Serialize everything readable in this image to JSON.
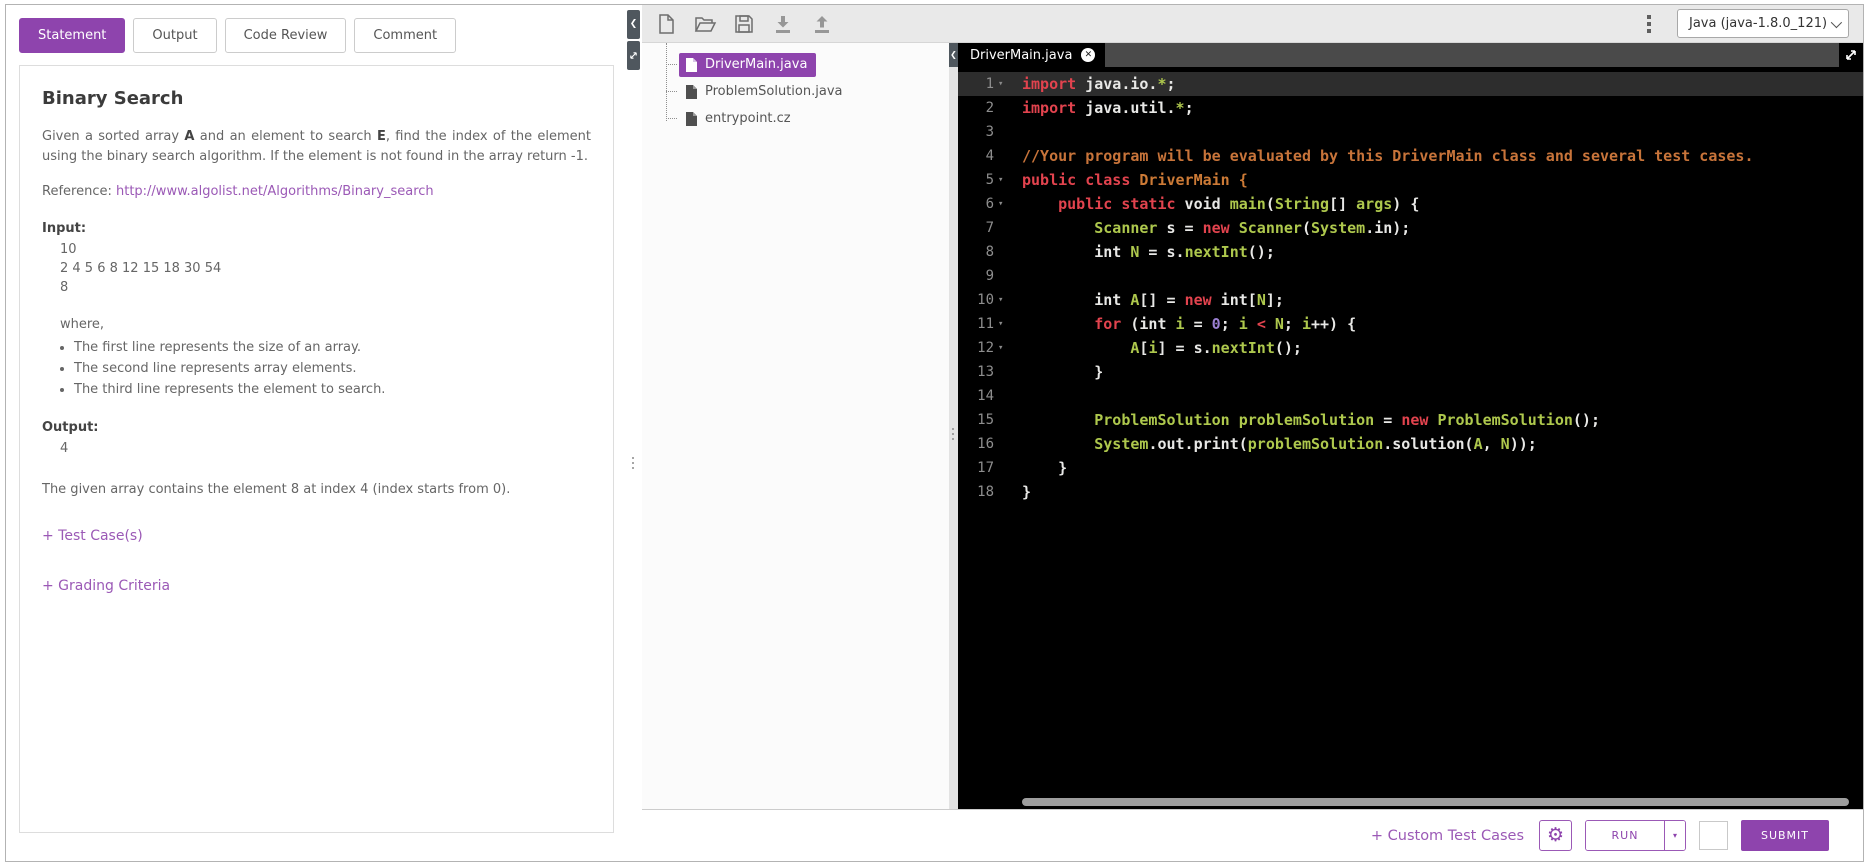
{
  "accent_color": "#8e44ad",
  "link_color": "#9b59b6",
  "left_panel": {
    "tabs": [
      {
        "label": "Statement",
        "active": true
      },
      {
        "label": "Output",
        "active": false
      },
      {
        "label": "Code Review",
        "active": false
      },
      {
        "label": "Comment",
        "active": false
      }
    ],
    "title": "Binary Search",
    "description": [
      {
        "t": "Given a sorted array "
      },
      {
        "b": "A"
      },
      {
        "t": " and an element to search "
      },
      {
        "b": "E"
      },
      {
        "t": ", find the index of the element using the binary search algorithm. If the element is not found in the array return -1."
      }
    ],
    "reference_label": "Reference: ",
    "reference_link": "http://www.algolist.net/Algorithms/Binary_search",
    "input_label": "Input:",
    "input_lines": [
      "10",
      "2 4 5 6 8 12 15 18 30 54",
      "8"
    ],
    "where_label": "where,",
    "input_bullets": [
      "The first line represents the size of an array.",
      "The second line represents array elements.",
      "The third line represents the element to search."
    ],
    "output_label": "Output:",
    "output_value": "4",
    "explanation": "The given array contains the element 8 at index 4 (index starts from 0).",
    "expanders": [
      "+ Test Case(s)",
      "+ Grading Criteria"
    ]
  },
  "file_toolbar": {
    "icons": [
      "new-file-icon",
      "open-folder-icon",
      "save-icon",
      "download-icon",
      "upload-icon"
    ]
  },
  "file_tree": {
    "files": [
      {
        "name": "DriverMain.java",
        "selected": true
      },
      {
        "name": "ProblemSolution.java",
        "selected": false
      },
      {
        "name": "entrypoint.cz",
        "selected": false
      }
    ]
  },
  "language_select": {
    "value": "Java (java-1.8.0_121)"
  },
  "editor": {
    "tab": "DriverMain.java",
    "syntax_colors": {
      "k": "#e2434e",
      "w": "#e8e8e6",
      "g": "#aec84d",
      "n": "#9a7fd1",
      "c": "#c8743a",
      "o": "#cc7a36"
    },
    "lines": [
      {
        "n": 1,
        "fold": true,
        "active": true,
        "tokens": [
          [
            "k",
            "import"
          ],
          [
            "w",
            " java.io."
          ],
          [
            "g",
            "*"
          ],
          [
            "w",
            ";"
          ]
        ]
      },
      {
        "n": 2,
        "tokens": [
          [
            "k",
            "import"
          ],
          [
            "w",
            " java.util."
          ],
          [
            "g",
            "*"
          ],
          [
            "w",
            ";"
          ]
        ]
      },
      {
        "n": 3,
        "tokens": []
      },
      {
        "n": 4,
        "tokens": [
          [
            "c",
            "//Your program will be evaluated by this DriverMain class and several test cases."
          ]
        ]
      },
      {
        "n": 5,
        "fold": true,
        "tokens": [
          [
            "k",
            "public class"
          ],
          [
            "o",
            " DriverMain {"
          ]
        ]
      },
      {
        "n": 6,
        "fold": true,
        "tokens": [
          [
            "w",
            "    "
          ],
          [
            "k",
            "public static"
          ],
          [
            "w",
            " void "
          ],
          [
            "g",
            "main"
          ],
          [
            "w",
            "("
          ],
          [
            "g",
            "String"
          ],
          [
            "w",
            "[] "
          ],
          [
            "g",
            "args"
          ],
          [
            "w",
            ") {"
          ]
        ]
      },
      {
        "n": 7,
        "tokens": [
          [
            "w",
            "        "
          ],
          [
            "g",
            "Scanner"
          ],
          [
            "w",
            " s = "
          ],
          [
            "k",
            "new"
          ],
          [
            "w",
            " "
          ],
          [
            "g",
            "Scanner"
          ],
          [
            "w",
            "("
          ],
          [
            "g",
            "System"
          ],
          [
            "w",
            ".in);"
          ]
        ]
      },
      {
        "n": 8,
        "tokens": [
          [
            "w",
            "        int "
          ],
          [
            "g",
            "N"
          ],
          [
            "w",
            " = s."
          ],
          [
            "g",
            "nextInt"
          ],
          [
            "w",
            "();"
          ]
        ]
      },
      {
        "n": 9,
        "tokens": []
      },
      {
        "n": 10,
        "fold": true,
        "tokens": [
          [
            "w",
            "        int "
          ],
          [
            "g",
            "A"
          ],
          [
            "w",
            "[] = "
          ],
          [
            "k",
            "new"
          ],
          [
            "w",
            " int["
          ],
          [
            "g",
            "N"
          ],
          [
            "w",
            "];"
          ]
        ]
      },
      {
        "n": 11,
        "fold": true,
        "tokens": [
          [
            "w",
            "        "
          ],
          [
            "k",
            "for"
          ],
          [
            "w",
            " (int "
          ],
          [
            "g",
            "i"
          ],
          [
            "w",
            " = "
          ],
          [
            "n",
            "0"
          ],
          [
            "w",
            "; "
          ],
          [
            "g",
            "i"
          ],
          [
            "w",
            " "
          ],
          [
            "k",
            "<"
          ],
          [
            "w",
            " "
          ],
          [
            "g",
            "N"
          ],
          [
            "w",
            "; "
          ],
          [
            "g",
            "i"
          ],
          [
            "w",
            "++) {"
          ]
        ]
      },
      {
        "n": 12,
        "fold": true,
        "tokens": [
          [
            "w",
            "            "
          ],
          [
            "g",
            "A"
          ],
          [
            "w",
            "["
          ],
          [
            "g",
            "i"
          ],
          [
            "w",
            "] = s."
          ],
          [
            "g",
            "nextInt"
          ],
          [
            "w",
            "();"
          ]
        ]
      },
      {
        "n": 13,
        "tokens": [
          [
            "w",
            "        }"
          ]
        ]
      },
      {
        "n": 14,
        "tokens": []
      },
      {
        "n": 15,
        "tokens": [
          [
            "w",
            "        "
          ],
          [
            "g",
            "ProblemSolution"
          ],
          [
            "w",
            " "
          ],
          [
            "g",
            "problemSolution"
          ],
          [
            "w",
            " = "
          ],
          [
            "k",
            "new"
          ],
          [
            "w",
            " "
          ],
          [
            "g",
            "ProblemSolution"
          ],
          [
            "w",
            "();"
          ]
        ]
      },
      {
        "n": 16,
        "tokens": [
          [
            "w",
            "        "
          ],
          [
            "g",
            "System"
          ],
          [
            "w",
            ".out.print("
          ],
          [
            "g",
            "problemSolution"
          ],
          [
            "w",
            ".solution("
          ],
          [
            "g",
            "A"
          ],
          [
            "w",
            ", "
          ],
          [
            "g",
            "N"
          ],
          [
            "w",
            "));"
          ]
        ]
      },
      {
        "n": 17,
        "tokens": [
          [
            "w",
            "    }"
          ]
        ]
      },
      {
        "n": 18,
        "tokens": [
          [
            "w",
            "}"
          ]
        ]
      }
    ]
  },
  "bottom_bar": {
    "custom_test_cases": "+ Custom Test Cases",
    "run_label": "RUN",
    "submit_label": "SUBMIT"
  }
}
